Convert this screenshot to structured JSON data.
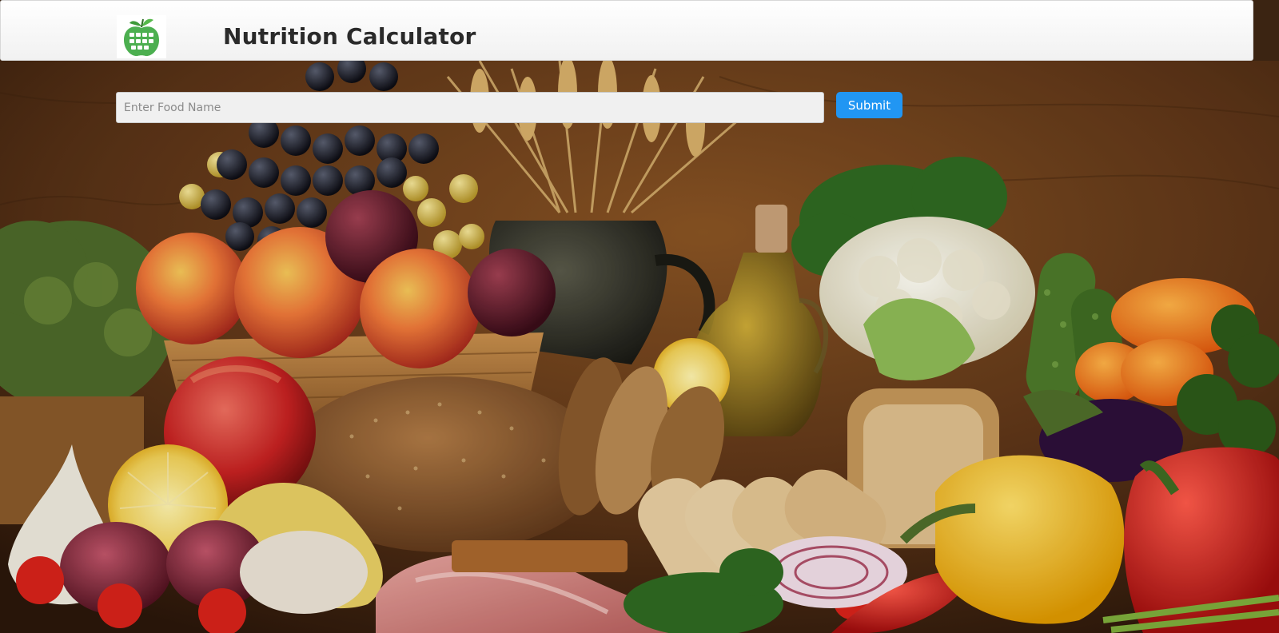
{
  "header": {
    "title": "Nutrition Calculator",
    "logo_icon": "calculator-apple-icon"
  },
  "search": {
    "placeholder": "Enter Food Name",
    "value": "",
    "submit_label": "Submit"
  },
  "colors": {
    "accent": "#2196f3",
    "logo_green": "#4caf50"
  },
  "background": {
    "image": "food-still-life-photo"
  }
}
